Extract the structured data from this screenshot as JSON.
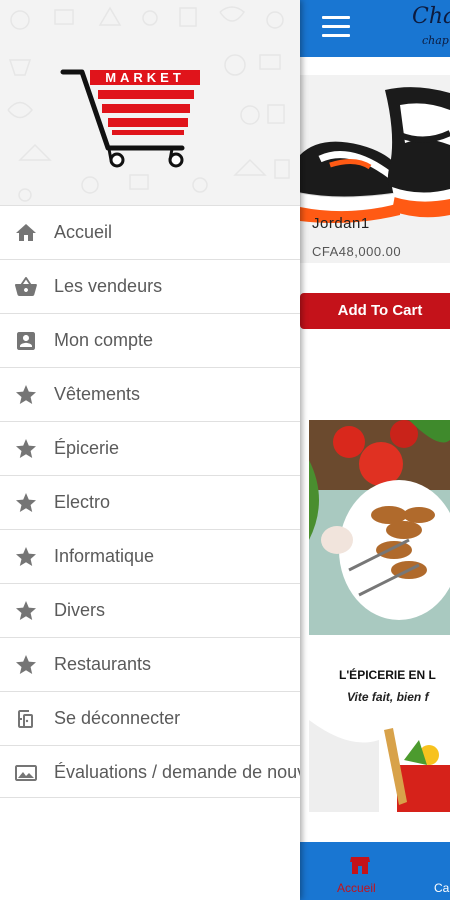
{
  "header": {
    "brand_script": "Chap",
    "brand_script_sub": "chap"
  },
  "product": {
    "name": "Jordan1",
    "price": "CFA48,000.00",
    "add_to_cart_label": "Add To Cart"
  },
  "banner": {
    "headline": "L'ÉPICERIE EN L",
    "tagline": "Vite fait, bien f"
  },
  "bottom_nav": {
    "accueil_label": "Accueil",
    "next_label": "Ca"
  },
  "logo": {
    "text": "MARKET"
  },
  "menu": {
    "items": [
      {
        "label": "Accueil",
        "icon": "home-icon"
      },
      {
        "label": "Les vendeurs",
        "icon": "basket-icon"
      },
      {
        "label": "Mon compte",
        "icon": "account-box-icon"
      },
      {
        "label": "Vêtements",
        "icon": "star-icon"
      },
      {
        "label": "Épicerie",
        "icon": "star-icon"
      },
      {
        "label": "Electro",
        "icon": "star-icon"
      },
      {
        "label": "Informatique",
        "icon": "star-icon"
      },
      {
        "label": "Divers",
        "icon": "star-icon"
      },
      {
        "label": "Restaurants",
        "icon": "star-icon"
      },
      {
        "label": "Se déconnecter",
        "icon": "logout-icon"
      },
      {
        "label": "Évaluations / demande de nouvelles fonctionnalités",
        "icon": "feedback-icon"
      }
    ]
  },
  "colors": {
    "primary_blue": "#1976d2",
    "accent_red": "#c4121a",
    "menu_text": "#5a5a5a",
    "menu_icon": "#757575"
  }
}
